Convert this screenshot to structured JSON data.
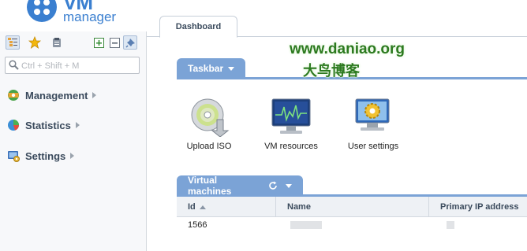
{
  "logo": {
    "title": "VM",
    "subtitle": "manager"
  },
  "sidebar": {
    "search_placeholder": "Ctrl + Shift + M",
    "toolbar": [
      {
        "icon": "tree-view-icon"
      },
      {
        "icon": "favorites-star-icon"
      },
      {
        "icon": "clipboard-icon"
      },
      {
        "icon": "expand-all-icon"
      },
      {
        "icon": "collapse-all-icon"
      },
      {
        "icon": "pin-icon"
      }
    ],
    "items": [
      {
        "label": "Management",
        "icon": "management-icon"
      },
      {
        "label": "Statistics",
        "icon": "statistics-pie-icon"
      },
      {
        "label": "Settings",
        "icon": "settings-icon"
      }
    ]
  },
  "tabs": [
    {
      "label": "Dashboard"
    }
  ],
  "taskbar": {
    "title": "Taskbar",
    "items": [
      {
        "label": "Upload ISO",
        "icon": "upload-iso-disc-icon"
      },
      {
        "label": "VM resources",
        "icon": "vm-resources-monitor-icon"
      },
      {
        "label": "User settings",
        "icon": "user-settings-gear-icon"
      }
    ]
  },
  "vms": {
    "title": "Virtual machines",
    "columns": [
      "Id",
      "Name",
      "Primary IP address"
    ],
    "rows": [
      {
        "id": "1566"
      }
    ]
  },
  "watermark": {
    "url": "www.daniao.org",
    "text": "大鸟博客"
  },
  "colors": {
    "accent": "#7ba3d6",
    "brand": "#3a7fd0",
    "watermark": "#2c7a1f"
  }
}
